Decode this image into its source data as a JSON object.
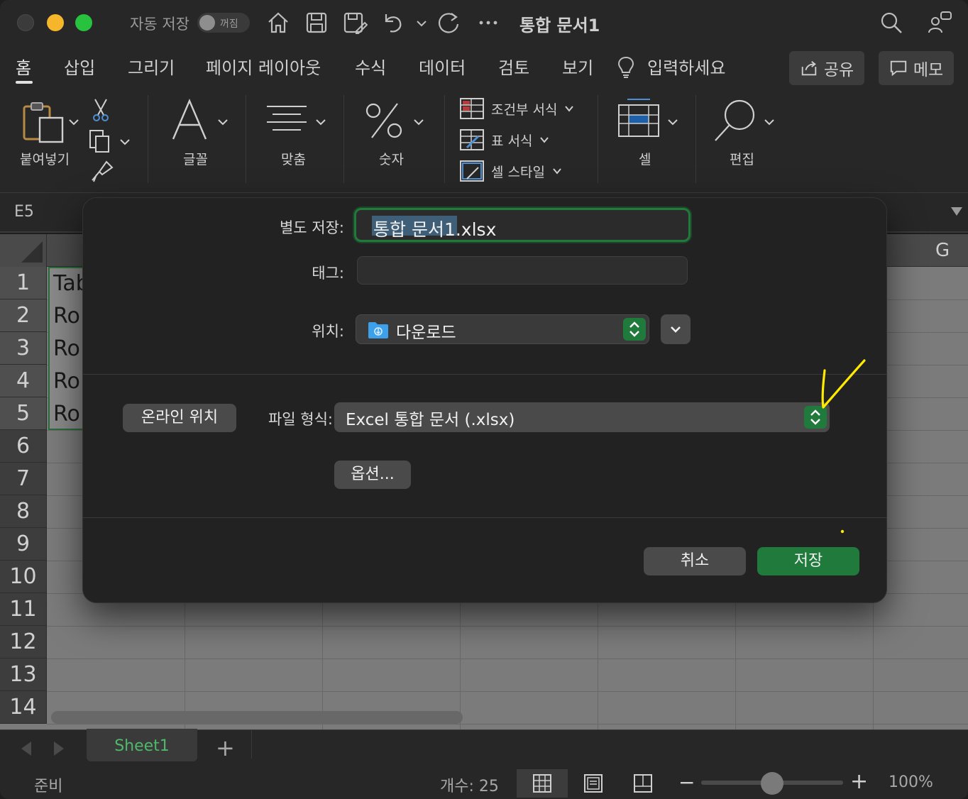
{
  "titlebar": {
    "autosave_label": "자동 저장",
    "autosave_state": "꺼짐",
    "document_title": "통합 문서1"
  },
  "ribbon_tabs": [
    "홈",
    "삽입",
    "그리기",
    "페이지 레이아웃",
    "수식",
    "데이터",
    "검토",
    "보기"
  ],
  "tell_me": "입력하세요",
  "share_label": "공유",
  "memo_label": "메모",
  "ribbon": {
    "paste": "붙여넣기",
    "font": "글꼴",
    "align": "맞춤",
    "number": "숫자",
    "conditional_format": "조건부 서식",
    "table_format": "표 서식",
    "cell_style": "셀 스타일",
    "cells": "셀",
    "editing": "편집"
  },
  "namebox": "E5",
  "columns": {
    "g": "G"
  },
  "rows": [
    "1",
    "2",
    "3",
    "4",
    "5",
    "6",
    "7",
    "8",
    "9",
    "10",
    "11",
    "12",
    "13",
    "14"
  ],
  "cells": [
    "Tab",
    "Ro",
    "Ro",
    "Ro",
    "Ro"
  ],
  "dialog": {
    "save_as_label": "별도 저장:",
    "filename_selected": "통합 문서1",
    "filename_ext": ".xlsx",
    "tags_label": "태그:",
    "location_label": "위치:",
    "location_value": "다운로드",
    "online_button": "온라인 위치",
    "format_label": "파일 형식:",
    "format_value": "Excel 통합 문서 (.xlsx)",
    "options_button": "옵션...",
    "cancel_button": "취소",
    "save_button": "저장"
  },
  "sheet_tab": "Sheet1",
  "status": {
    "ready": "준비",
    "count": "개수: 25",
    "zoom": "100%"
  },
  "colors": {
    "accent_green": "#1f7a3c",
    "annotation_yellow": "#ffeb00"
  }
}
